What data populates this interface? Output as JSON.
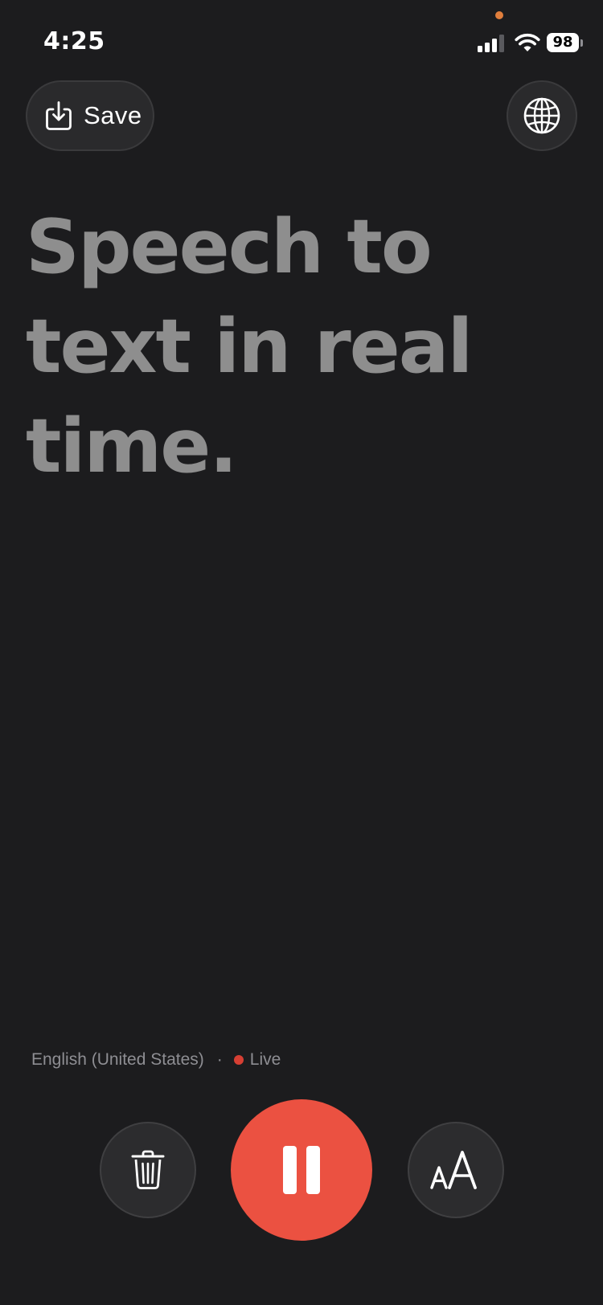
{
  "status_bar": {
    "time": "4:25",
    "battery_level": "98",
    "icons": [
      "signal-icon",
      "wifi-icon",
      "battery-icon"
    ]
  },
  "toolbar": {
    "save_label": "Save",
    "save_icon": "save-download-icon",
    "language_icon": "globe-icon"
  },
  "transcript": {
    "text": "Speech to text in real time."
  },
  "session": {
    "language": "English (United States)",
    "separator": "·",
    "status": "Live"
  },
  "controls": {
    "delete_icon": "trash-icon",
    "pause_icon": "pause-icon",
    "text_size_icon": "text-size-icon"
  },
  "colors": {
    "background": "#1c1c1e",
    "accent": "#eb5141",
    "live_dot": "#d63f33",
    "transcript_text": "#8e8e8e",
    "privacy_indicator": "#e07e3c"
  }
}
